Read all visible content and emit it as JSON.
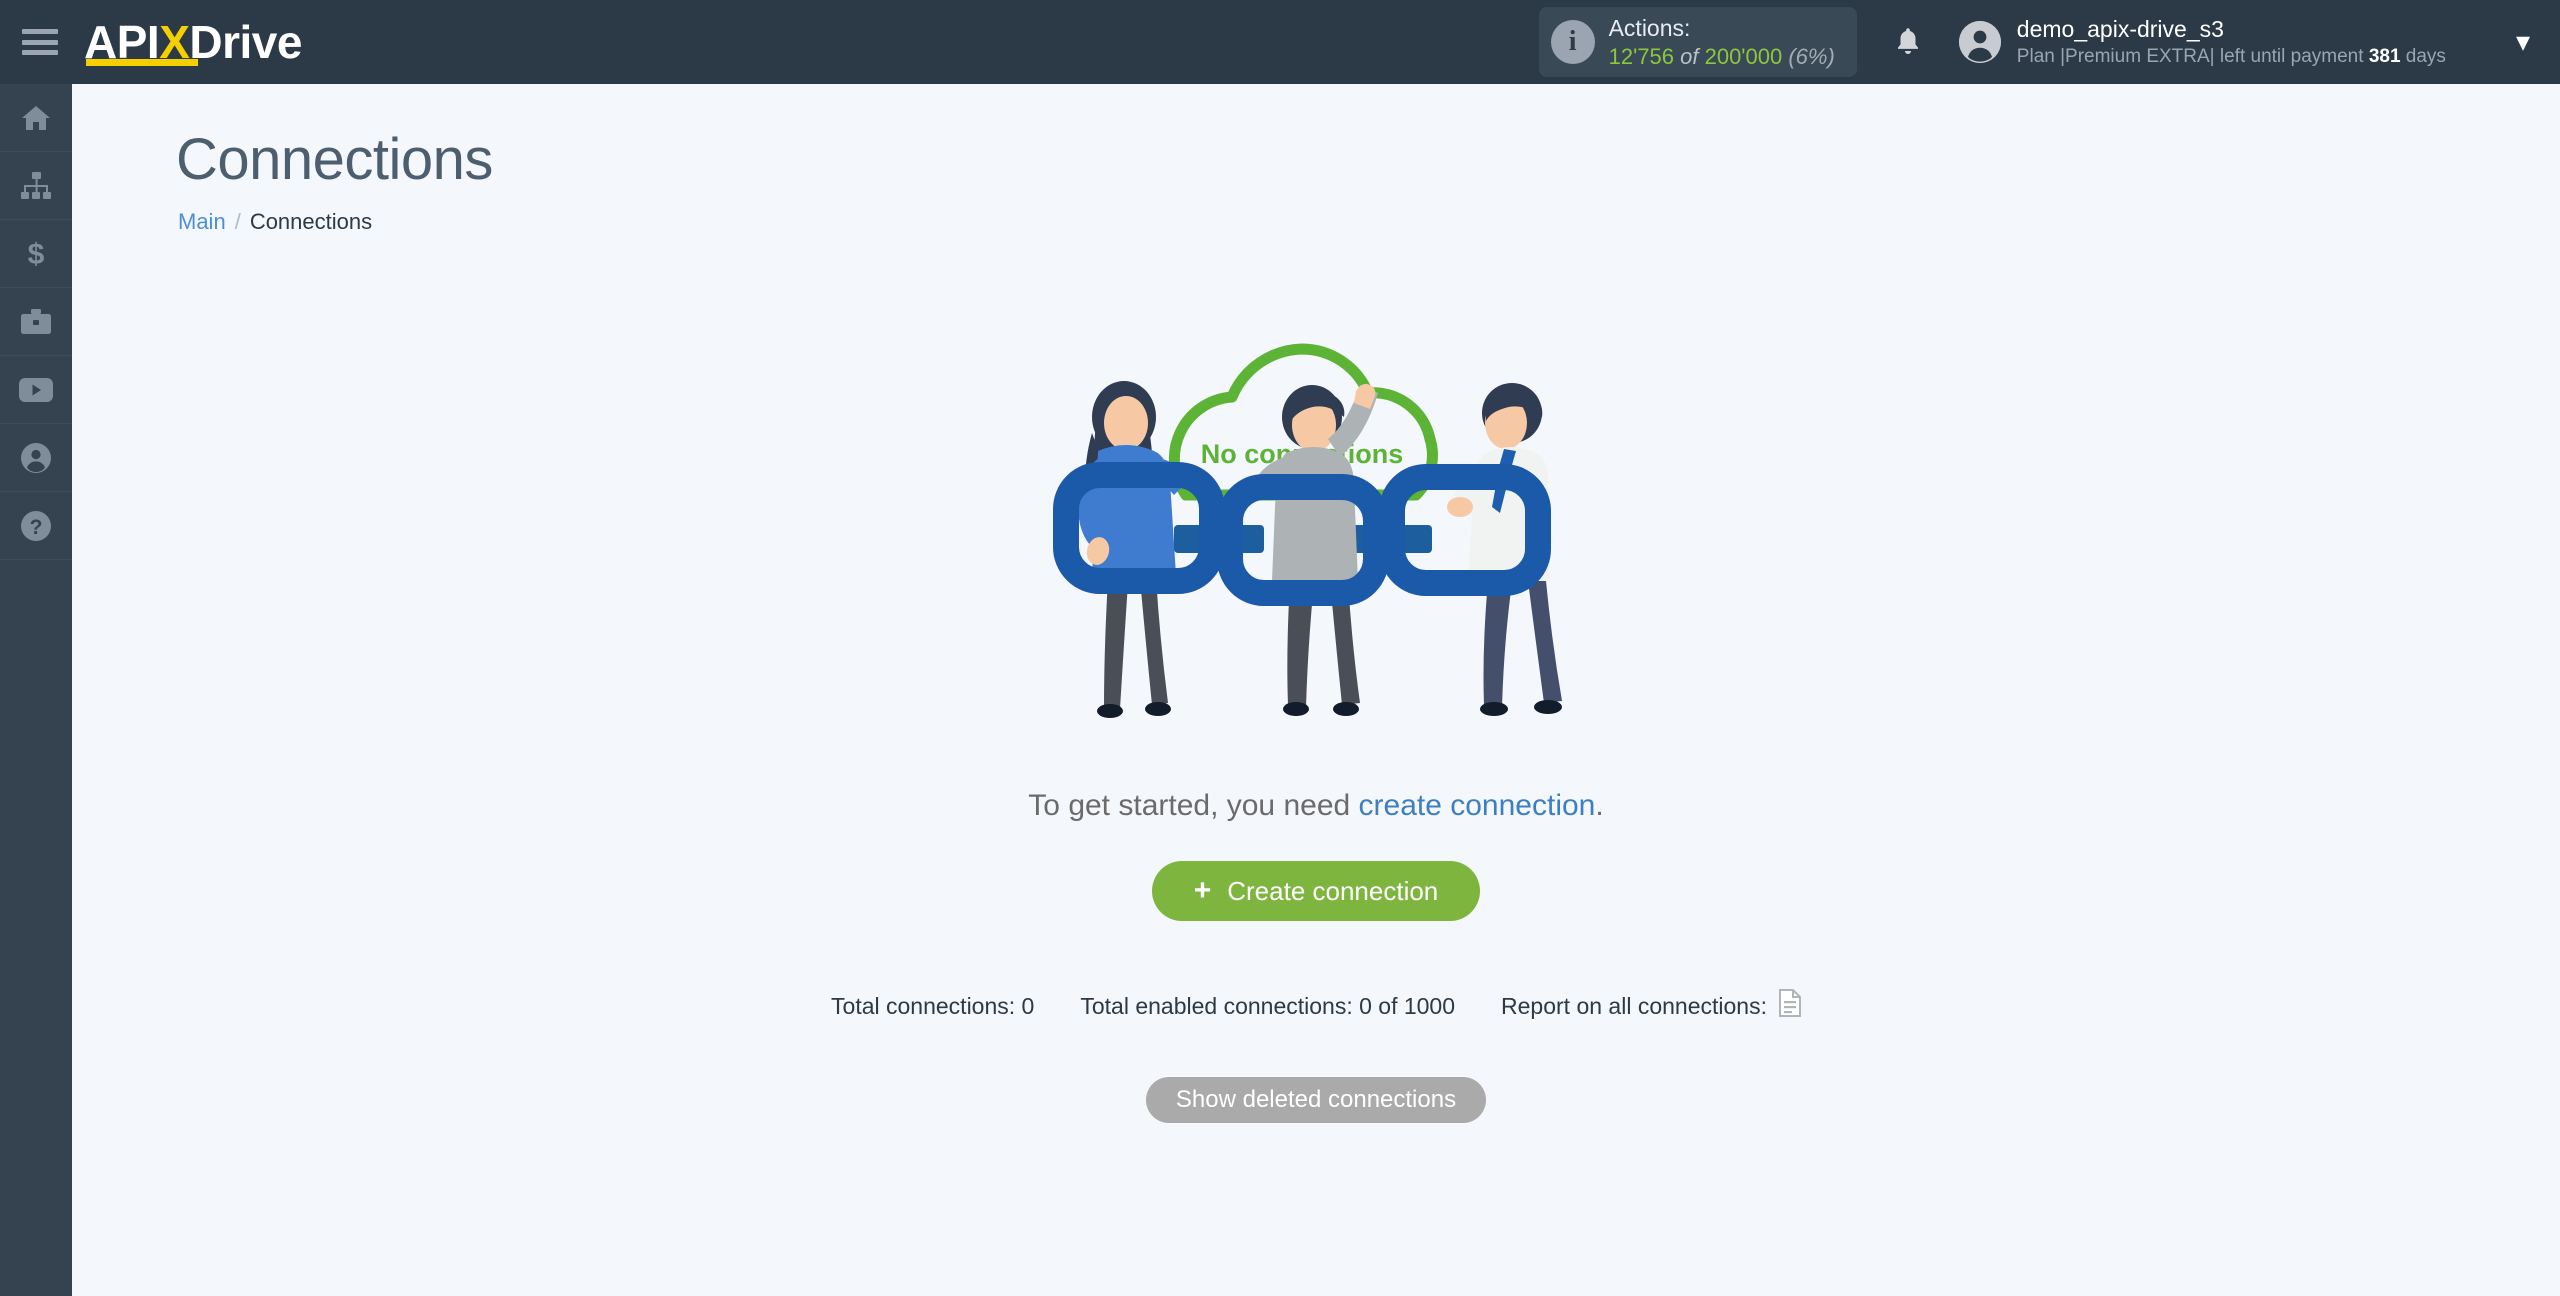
{
  "header": {
    "menu_icon": "hamburger-menu-icon",
    "logo": {
      "part1": "API",
      "accent": "X",
      "part2": "Drive"
    },
    "actions": {
      "info_icon": "info-icon",
      "label": "Actions:",
      "used": "12'756",
      "of": "of",
      "total": "200'000",
      "percent": "(6%)"
    },
    "bell_icon": "notification-bell-icon",
    "user": {
      "avatar_icon": "user-avatar-icon",
      "name": "demo_apix-drive_s3",
      "plan_prefix": "Plan |Premium EXTRA| left until payment ",
      "plan_days": "381",
      "plan_suffix": " days"
    },
    "dropdown_icon": "chevron-down-icon"
  },
  "sidebar": {
    "items": [
      {
        "name": "home",
        "icon": "home-icon"
      },
      {
        "name": "connections",
        "icon": "sitemap-icon"
      },
      {
        "name": "billing",
        "icon": "dollar-icon"
      },
      {
        "name": "business",
        "icon": "briefcase-icon"
      },
      {
        "name": "video",
        "icon": "youtube-icon"
      },
      {
        "name": "account",
        "icon": "user-circle-icon"
      },
      {
        "name": "help",
        "icon": "question-circle-icon"
      }
    ]
  },
  "page": {
    "title": "Connections",
    "breadcrumb": {
      "root": "Main",
      "separator": "/",
      "current": "Connections"
    }
  },
  "empty_state": {
    "cloud_label": "No connections",
    "message_prefix": "To get started, you need ",
    "message_link": "create connection",
    "message_suffix": ".",
    "create_button": {
      "label": "Create connection",
      "icon": "plus-icon"
    }
  },
  "stats": {
    "total_connections": "Total connections: 0",
    "total_enabled": "Total enabled connections: 0 of 1000",
    "report_label": "Report on all connections:",
    "report_icon": "document-icon"
  },
  "footer_actions": {
    "show_deleted": "Show deleted connections"
  },
  "colors": {
    "header_bg": "#2c3a47",
    "sidebar_bg": "#34434f",
    "page_bg": "#f4f7fb",
    "accent_yellow": "#f5cf00",
    "green": "#7eb53f",
    "green_cloud": "#5cb335",
    "link_blue": "#4a90d9",
    "chain_blue": "#1a5aa8",
    "grey_button": "#aaaaaa"
  }
}
